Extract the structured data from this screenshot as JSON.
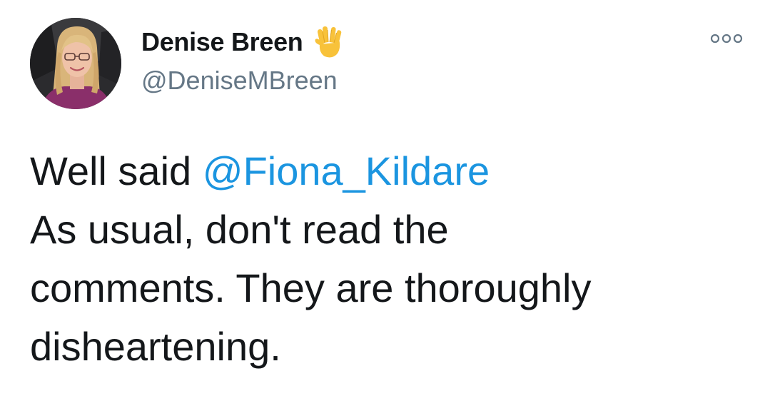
{
  "author": {
    "display_name": "Denise Breen",
    "handle": "@DeniseMBreen",
    "name_emoji": "vulcan-salute-hand"
  },
  "tweet": {
    "line1_prefix": "Well said ",
    "mention": "@Fiona_Kildare",
    "line2": "As usual, don't read the",
    "line3": "comments. They are thoroughly",
    "line4": "disheartening."
  },
  "colors": {
    "text": "#14171a",
    "secondary": "#657786",
    "link": "#1b95e0",
    "emoji": "#f8c23a"
  },
  "icons": {
    "menu": "more-options-icon",
    "avatar": "profile-photo"
  }
}
